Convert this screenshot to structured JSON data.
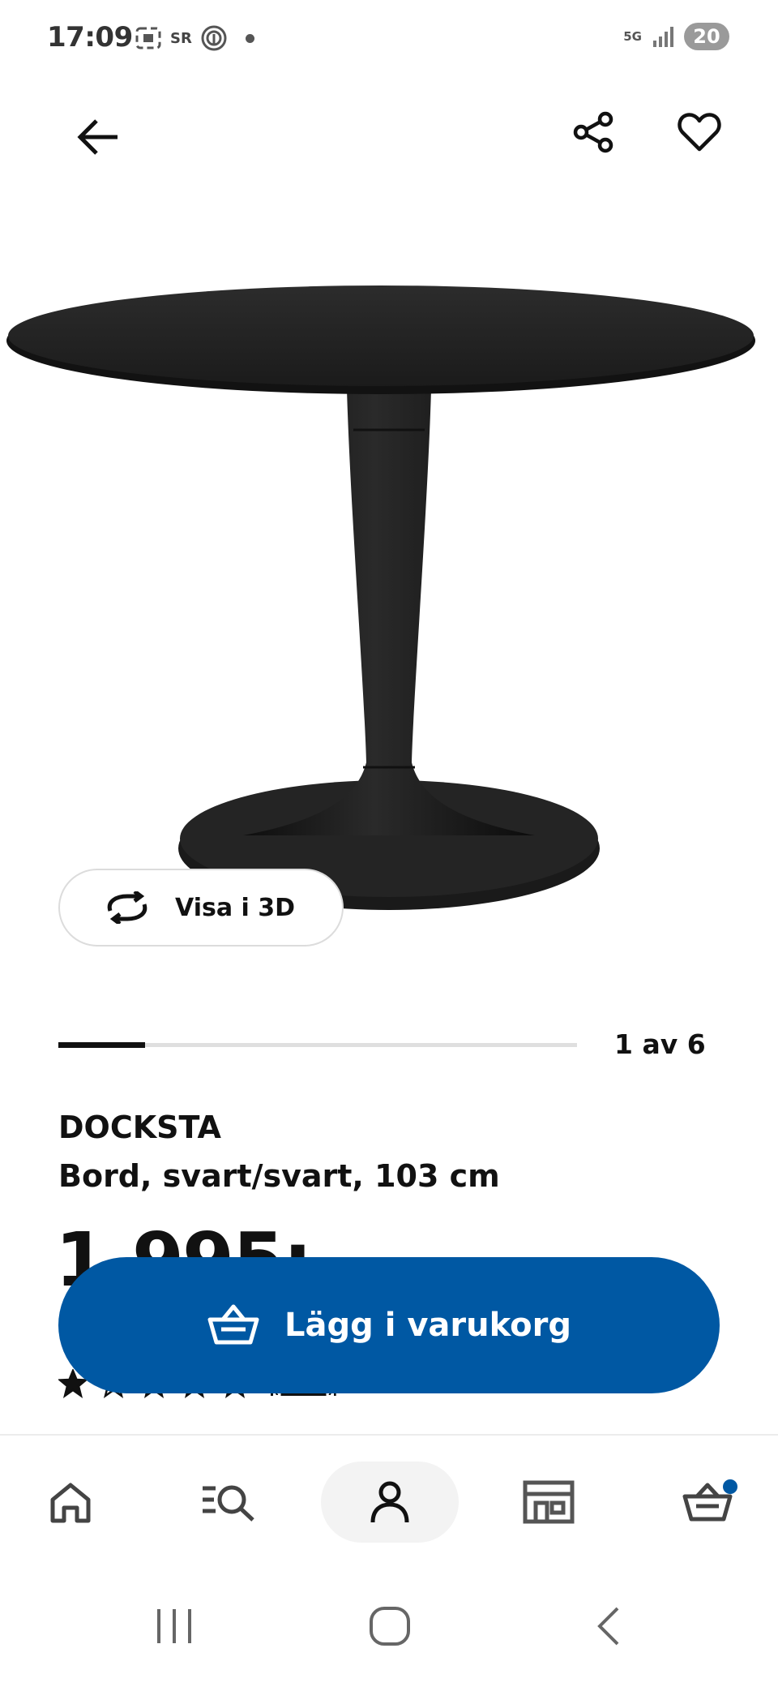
{
  "status_bar": {
    "time": "17:09",
    "sr_label": "SR",
    "network": "5G",
    "battery": "20"
  },
  "header": {
    "back_icon": "arrow-left-icon",
    "share_icon": "share-icon",
    "favorite_icon": "heart-icon"
  },
  "gallery": {
    "view_3d_label": "Visa i 3D",
    "counter": "1 av 6",
    "progress_fraction": 0.1667
  },
  "product": {
    "name": "DOCKSTA",
    "description": "Bord, svart/svart, 103 cm",
    "price": "1.995:-",
    "rating_stars": 1,
    "rating_max": 5,
    "review_count": "(313)"
  },
  "add_to_cart": {
    "label": "Lägg i varukorg"
  },
  "bottom_nav": {
    "items": [
      "home",
      "search",
      "profile",
      "stores",
      "cart"
    ],
    "active": "profile"
  },
  "colors": {
    "primary": "#0058a3",
    "text": "#111111"
  }
}
